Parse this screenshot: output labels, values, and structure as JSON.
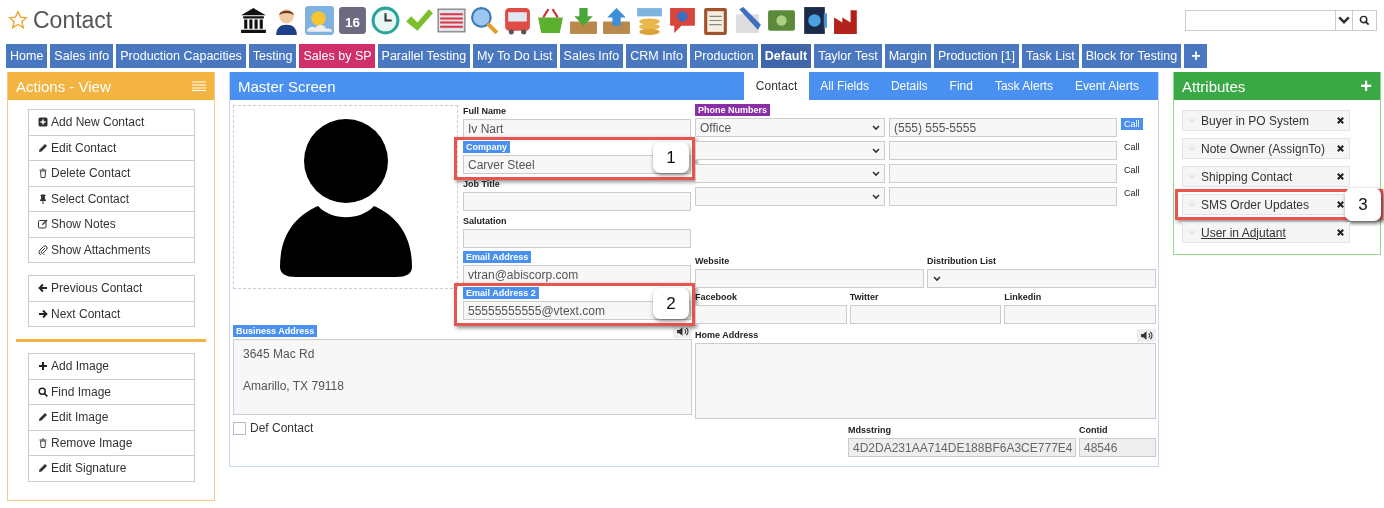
{
  "page_title": "Contact",
  "toolbar": {
    "calendar_day": "16"
  },
  "tabs": [
    {
      "label": "Home",
      "selected": false,
      "bold": false
    },
    {
      "label": "Sales info",
      "selected": false,
      "bold": false
    },
    {
      "label": "Production Capacities",
      "selected": false,
      "bold": false
    },
    {
      "label": "Testing",
      "selected": false,
      "bold": false
    },
    {
      "label": "Sales by SP",
      "selected": true,
      "bold": false
    },
    {
      "label": "Parallel Testing",
      "selected": false,
      "bold": false
    },
    {
      "label": "My To Do List",
      "selected": false,
      "bold": false
    },
    {
      "label": "Sales Info",
      "selected": false,
      "bold": false
    },
    {
      "label": "CRM Info",
      "selected": false,
      "bold": false
    },
    {
      "label": "Production",
      "selected": false,
      "bold": false
    },
    {
      "label": "Default",
      "selected": false,
      "bold": true
    },
    {
      "label": "Taylor Test",
      "selected": false,
      "bold": false
    },
    {
      "label": "Margin",
      "selected": false,
      "bold": false
    },
    {
      "label": "Production [1]",
      "selected": false,
      "bold": false
    },
    {
      "label": "Task List",
      "selected": false,
      "bold": false
    },
    {
      "label": "Block for Testing",
      "selected": false,
      "bold": false
    }
  ],
  "add_tab": "+",
  "actions": {
    "title": "Actions - View",
    "groups": [
      {
        "separator": false,
        "items": [
          {
            "kind": "plus-square",
            "label": "Add New Contact"
          },
          {
            "kind": "pencil",
            "label": "Edit Contact"
          },
          {
            "kind": "trash",
            "label": "Delete Contact"
          },
          {
            "kind": "pin",
            "label": "Select Contact"
          },
          {
            "kind": "note",
            "label": "Show Notes"
          },
          {
            "kind": "clip",
            "label": "Show Attachments"
          }
        ]
      },
      {
        "separator": false,
        "items": [
          {
            "kind": "left",
            "label": "Previous Contact"
          },
          {
            "kind": "right",
            "label": "Next Contact"
          }
        ]
      },
      {
        "separator": true,
        "items": [
          {
            "kind": "plus",
            "label": "Add Image"
          },
          {
            "kind": "search",
            "label": "Find Image"
          },
          {
            "kind": "pencil",
            "label": "Edit Image"
          },
          {
            "kind": "trash",
            "label": "Remove Image"
          },
          {
            "kind": "pencil",
            "label": "Edit Signature"
          }
        ]
      }
    ]
  },
  "master": {
    "title": "Master Screen",
    "tabs": [
      {
        "label": "Contact",
        "selected": true
      },
      {
        "label": "All Fields",
        "selected": false
      },
      {
        "label": "Details",
        "selected": false
      },
      {
        "label": "Find",
        "selected": false
      },
      {
        "label": "Task Alerts",
        "selected": false
      },
      {
        "label": "Event Alerts",
        "selected": false
      }
    ],
    "fields": [
      {
        "label": "Full Name",
        "kind": "plain",
        "value": "Iv Nart"
      },
      {
        "label": "Company",
        "kind": "tag",
        "value": "Carver Steel",
        "callout": "1"
      },
      {
        "label": "Job Title",
        "kind": "plain"
      },
      {
        "label": "Salutation",
        "kind": "plain"
      },
      {
        "label": "Email Address",
        "kind": "tag",
        "value": "vtran@abiscorp.com"
      },
      {
        "label": "Email Address 2",
        "kind": "tag",
        "value": "55555555555@vtext.com",
        "callout": "2"
      }
    ],
    "phones": {
      "label": "Phone Numbers",
      "rows": [
        {
          "type": "Office",
          "number": "(555) 555-5555",
          "call": "Call",
          "primary": true
        },
        {
          "call": "Call",
          "primary": false
        },
        {
          "call": "Call",
          "primary": false
        },
        {
          "call": "Call",
          "primary": false
        }
      ]
    },
    "website": {
      "label": "Website"
    },
    "distribution": {
      "label": "Distribution List"
    },
    "socials": [
      {
        "label": "Facebook"
      },
      {
        "label": "Twitter"
      },
      {
        "label": "Linkedin"
      }
    ],
    "business_address": {
      "label": "Business Address",
      "value": "3645 Mac Rd\n\nAmarillo, TX 79118"
    },
    "home_address": {
      "label": "Home Address"
    },
    "def_contact": {
      "label": "Def Contact",
      "checked": false
    },
    "mdsstring": {
      "label": "Mdsstring",
      "value": "4D2DA231AA714DE188BF6A3CE777E4"
    },
    "contid": {
      "label": "Contid",
      "value": "48546"
    }
  },
  "attributes": {
    "title": "Attributes",
    "add": "+",
    "items": [
      {
        "label": "Buyer in PO System",
        "link": false
      },
      {
        "label": "Note Owner (AssignTo)",
        "link": false
      },
      {
        "label": "Shipping Contact",
        "link": false
      },
      {
        "label": "SMS Order Updates",
        "link": false,
        "callout": "3"
      },
      {
        "label": "User in Adjutant",
        "link": true
      }
    ]
  }
}
